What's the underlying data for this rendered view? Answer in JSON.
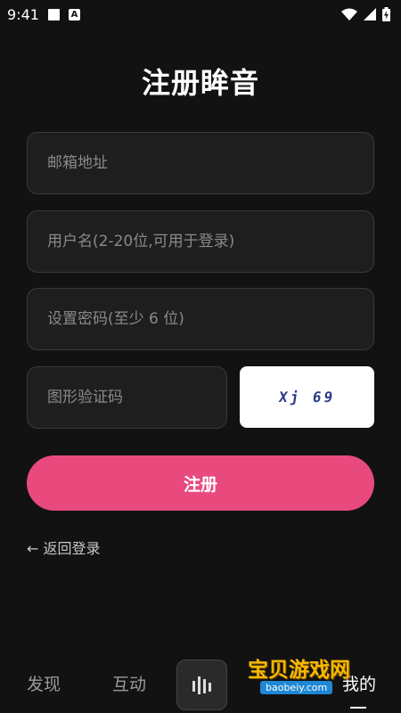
{
  "status_bar": {
    "time": "9:41"
  },
  "page_title": "注册眸音",
  "form": {
    "email_placeholder": "邮箱地址",
    "username_placeholder": "用户名(2-20位,可用于登录)",
    "password_placeholder": "设置密码(至少 6 位)",
    "captcha_placeholder": "图形验证码",
    "captcha_image_text": "Xj 69"
  },
  "register_button": "注册",
  "back_link": "← 返回登录",
  "bottom_nav": {
    "discover": "发现",
    "interact": "互动",
    "mine": "我的"
  },
  "watermark": {
    "text": "宝贝游戏网",
    "url": "baobeiy.com"
  },
  "colors": {
    "accent": "#e84a7e",
    "background": "#121212",
    "field_bg": "#1e1e1e"
  }
}
